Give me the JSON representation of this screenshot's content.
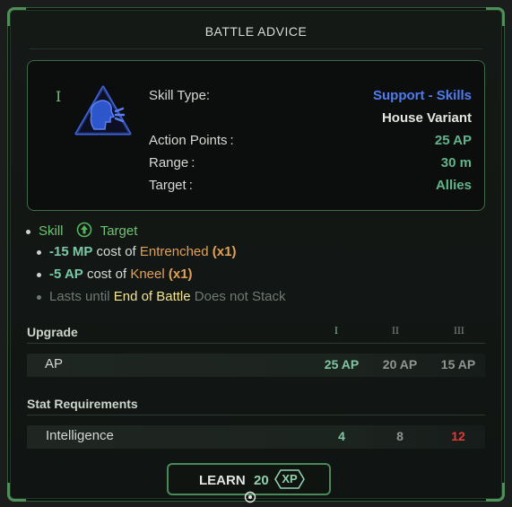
{
  "title": "BATTLE ADVICE",
  "tier_mark": "I",
  "icons": {
    "skill": "shout-head-icon",
    "target": "ally-arrow-icon",
    "xp": "xp-hexagon-icon",
    "cursor": "target-reticle-icon"
  },
  "colors": {
    "accent_green": "#4e8f5a",
    "skill_blue": "#4d7cf0",
    "value_green": "#5fb58a",
    "orange": "#e3a24c",
    "red": "#e23a3a"
  },
  "skill_info": {
    "skill_type_label": "Skill Type:",
    "skill_type_value": "Support - Skills",
    "variant": "House Variant",
    "ap_label": "Action Points :",
    "ap_value": "25 AP",
    "range_label": "Range :",
    "range_value": "30 m",
    "target_label": "Target :",
    "target_value": "Allies"
  },
  "effects": {
    "skill_word": "Skill",
    "target_word": "Target",
    "line1": {
      "amount": "-15 MP",
      "text": "cost of",
      "skill": "Entrenched",
      "mult": "(x1)"
    },
    "line2": {
      "amount": "-5 AP",
      "text": "cost of",
      "skill": "Kneel",
      "mult": "(x1)"
    },
    "line3": {
      "prefix": "Lasts until",
      "duration": "End of Battle",
      "suffix": "Does not Stack"
    }
  },
  "upgrade": {
    "title": "Upgrade",
    "levels": [
      "I",
      "II",
      "III"
    ],
    "row_label": "AP",
    "values": [
      "25 AP",
      "20 AP",
      "15 AP"
    ]
  },
  "requirements": {
    "title": "Stat Requirements",
    "row_label": "Intelligence",
    "values": [
      "4",
      "8",
      "12"
    ]
  },
  "learn_button": {
    "label": "LEARN",
    "cost": "20",
    "currency": "XP"
  }
}
